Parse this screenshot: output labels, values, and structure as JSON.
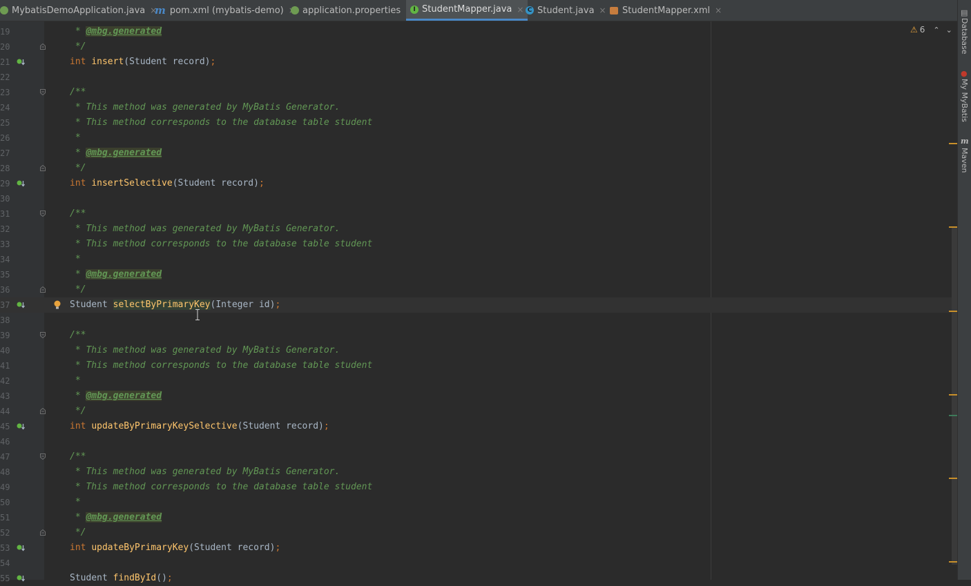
{
  "tabs": [
    {
      "label": "MybatisDemoApplication.java",
      "icon": "spring-class-icon",
      "active": false
    },
    {
      "label": "pom.xml (mybatis-demo)",
      "icon": "maven-icon",
      "active": false
    },
    {
      "label": "application.properties",
      "icon": "properties-icon",
      "active": false
    },
    {
      "label": "StudentMapper.java",
      "icon": "interface-icon",
      "active": true
    },
    {
      "label": "Student.java",
      "icon": "class-icon",
      "active": false
    },
    {
      "label": "StudentMapper.xml",
      "icon": "xml-icon",
      "active": false
    }
  ],
  "tab_close_glyph": "×",
  "inspection": {
    "warning_count": "6",
    "warn_glyph": "⚠",
    "up": "⌃",
    "down": "⌄"
  },
  "right_tool_windows": [
    "Database",
    "My MyBatis",
    "Maven"
  ],
  "lines": [
    {
      "n": "19",
      "tokens": [
        {
          "t": " * ",
          "c": "cm"
        },
        {
          "t": "@mbg.generated",
          "c": "tag"
        }
      ]
    },
    {
      "n": "20",
      "tokens": [
        {
          "t": " */",
          "c": "cm"
        }
      ]
    },
    {
      "n": "21",
      "tokens": [
        {
          "t": "int ",
          "c": "kw"
        },
        {
          "t": "insert",
          "c": "fn"
        },
        {
          "t": "(Student record)",
          "c": "pl"
        },
        {
          "t": ";",
          "c": "kw"
        }
      ]
    },
    {
      "n": "22",
      "tokens": []
    },
    {
      "n": "23",
      "tokens": [
        {
          "t": "/**",
          "c": "cm"
        }
      ]
    },
    {
      "n": "24",
      "tokens": [
        {
          "t": " * This method was generated by MyBatis Generator.",
          "c": "cm"
        }
      ]
    },
    {
      "n": "25",
      "tokens": [
        {
          "t": " * This method corresponds to the database table student",
          "c": "cm"
        }
      ]
    },
    {
      "n": "26",
      "tokens": [
        {
          "t": " *",
          "c": "cm"
        }
      ]
    },
    {
      "n": "27",
      "tokens": [
        {
          "t": " * ",
          "c": "cm"
        },
        {
          "t": "@mbg.generated",
          "c": "tag"
        }
      ]
    },
    {
      "n": "28",
      "tokens": [
        {
          "t": " */",
          "c": "cm"
        }
      ]
    },
    {
      "n": "29",
      "tokens": [
        {
          "t": "int ",
          "c": "kw"
        },
        {
          "t": "insertSelective",
          "c": "fn"
        },
        {
          "t": "(Student record)",
          "c": "pl"
        },
        {
          "t": ";",
          "c": "kw"
        }
      ]
    },
    {
      "n": "30",
      "tokens": []
    },
    {
      "n": "31",
      "tokens": [
        {
          "t": "/**",
          "c": "cm"
        }
      ]
    },
    {
      "n": "32",
      "tokens": [
        {
          "t": " * This method was generated by MyBatis Generator.",
          "c": "cm"
        }
      ]
    },
    {
      "n": "33",
      "tokens": [
        {
          "t": " * This method corresponds to the database table student",
          "c": "cm"
        }
      ]
    },
    {
      "n": "34",
      "tokens": [
        {
          "t": " *",
          "c": "cm"
        }
      ]
    },
    {
      "n": "35",
      "tokens": [
        {
          "t": " * ",
          "c": "cm"
        },
        {
          "t": "@mbg.generated",
          "c": "tag"
        }
      ]
    },
    {
      "n": "36",
      "tokens": [
        {
          "t": " */",
          "c": "cm"
        }
      ]
    },
    {
      "n": "37",
      "tokens": [
        {
          "t": "Student ",
          "c": "pl"
        },
        {
          "t": "selectByPrimaryKey",
          "c": "fnh"
        },
        {
          "t": "(Integer id)",
          "c": "pl"
        },
        {
          "t": ";",
          "c": "kw"
        }
      ]
    },
    {
      "n": "38",
      "tokens": []
    },
    {
      "n": "39",
      "tokens": [
        {
          "t": "/**",
          "c": "cm"
        }
      ]
    },
    {
      "n": "40",
      "tokens": [
        {
          "t": " * This method was generated by MyBatis Generator.",
          "c": "cm"
        }
      ]
    },
    {
      "n": "41",
      "tokens": [
        {
          "t": " * This method corresponds to the database table student",
          "c": "cm"
        }
      ]
    },
    {
      "n": "42",
      "tokens": [
        {
          "t": " *",
          "c": "cm"
        }
      ]
    },
    {
      "n": "43",
      "tokens": [
        {
          "t": " * ",
          "c": "cm"
        },
        {
          "t": "@mbg.generated",
          "c": "tag"
        }
      ]
    },
    {
      "n": "44",
      "tokens": [
        {
          "t": " */",
          "c": "cm"
        }
      ]
    },
    {
      "n": "45",
      "tokens": [
        {
          "t": "int ",
          "c": "kw"
        },
        {
          "t": "updateByPrimaryKeySelective",
          "c": "fn"
        },
        {
          "t": "(Student record)",
          "c": "pl"
        },
        {
          "t": ";",
          "c": "kw"
        }
      ]
    },
    {
      "n": "46",
      "tokens": []
    },
    {
      "n": "47",
      "tokens": [
        {
          "t": "/**",
          "c": "cm"
        }
      ]
    },
    {
      "n": "48",
      "tokens": [
        {
          "t": " * This method was generated by MyBatis Generator.",
          "c": "cm"
        }
      ]
    },
    {
      "n": "49",
      "tokens": [
        {
          "t": " * This method corresponds to the database table student",
          "c": "cm"
        }
      ]
    },
    {
      "n": "50",
      "tokens": [
        {
          "t": " *",
          "c": "cm"
        }
      ]
    },
    {
      "n": "51",
      "tokens": [
        {
          "t": " * ",
          "c": "cm"
        },
        {
          "t": "@mbg.generated",
          "c": "tag"
        }
      ]
    },
    {
      "n": "52",
      "tokens": [
        {
          "t": " */",
          "c": "cm"
        }
      ]
    },
    {
      "n": "53",
      "tokens": [
        {
          "t": "int ",
          "c": "kw"
        },
        {
          "t": "updateByPrimaryKey",
          "c": "fn"
        },
        {
          "t": "(Student record)",
          "c": "pl"
        },
        {
          "t": ";",
          "c": "kw"
        }
      ]
    },
    {
      "n": "54",
      "tokens": []
    },
    {
      "n": "55",
      "tokens": [
        {
          "t": "Student ",
          "c": "pl"
        },
        {
          "t": "findById",
          "c": "fn"
        },
        {
          "t": "()",
          "c": "pl"
        },
        {
          "t": ";",
          "c": "kw"
        }
      ]
    }
  ],
  "method_lines": [
    "21",
    "29",
    "37",
    "45",
    "53",
    "55"
  ],
  "fold_lines": [
    "20",
    "23",
    "28",
    "31",
    "36",
    "39",
    "44",
    "47",
    "52"
  ],
  "current_line": "37",
  "colors": {
    "accent": "#4a88c7",
    "warning": "#e8a33d",
    "gutter_icon": "#62b543"
  }
}
